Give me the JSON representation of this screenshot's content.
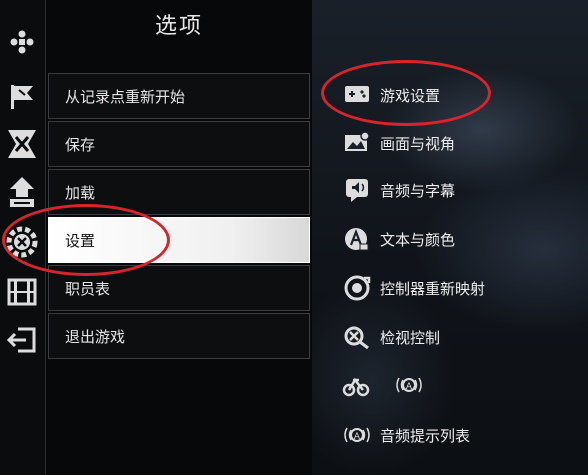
{
  "menu": {
    "title": "选项",
    "items": [
      {
        "label": "从记录点重新开始"
      },
      {
        "label": "保存"
      },
      {
        "label": "加载"
      },
      {
        "label": "设置"
      },
      {
        "label": "职员表"
      },
      {
        "label": "退出游戏"
      }
    ],
    "selected_index": 3
  },
  "settings_menu": {
    "items": [
      {
        "label": "游戏设置",
        "icon": "gamepad-settings-icon"
      },
      {
        "label": "画面与视角",
        "icon": "display-icon"
      },
      {
        "label": "音频与字幕",
        "icon": "audio-subtitle-icon"
      },
      {
        "label": "文本与颜色",
        "icon": "text-color-icon"
      },
      {
        "label": "控制器重新映射",
        "icon": "controller-remap-icon"
      },
      {
        "label": "检视控制",
        "icon": "inspect-control-icon"
      },
      {
        "label": "",
        "icon": "accessibility-audio-icon"
      },
      {
        "label": "音频提示列表",
        "icon": "audio-cue-icon"
      }
    ]
  },
  "rail_icons": [
    "dpad-icon",
    "flag-icon",
    "map-icon",
    "arrow-up-icon",
    "gear-icon",
    "film-icon",
    "exit-icon"
  ],
  "colors": {
    "annotation_red": "#d8242a",
    "selected_bg": "#ffffff",
    "text_light": "#e6e6e6"
  }
}
